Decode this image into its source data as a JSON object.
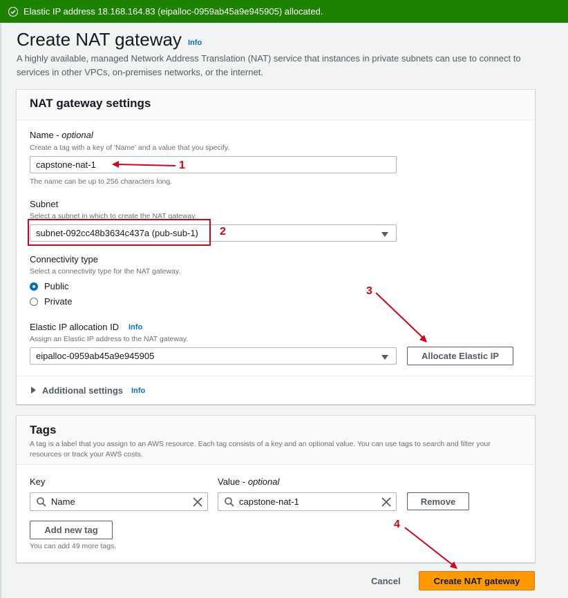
{
  "banner": {
    "message": "Elastic IP address 18.168.164.83 (eipalloc-0959ab45a9e945905) allocated.",
    "color": "#1d8102"
  },
  "page": {
    "title": "Create NAT gateway",
    "info": "Info",
    "description": "A highly available, managed Network Address Translation (NAT) service that instances in private subnets can use to connect to services in other VPCs, on-premises networks, or the internet."
  },
  "settings": {
    "heading": "NAT gateway settings",
    "name": {
      "label": "Name - ",
      "label_optional": "optional",
      "hint": "Create a tag with a key of 'Name' and a value that you specify.",
      "value": "capstone-nat-1",
      "constraint": "The name can be up to 256 characters long."
    },
    "subnet": {
      "label": "Subnet",
      "hint": "Select a subnet in which to create the NAT gateway.",
      "value": "subnet-092cc48b3634c437a (pub-sub-1)"
    },
    "connectivity": {
      "label": "Connectivity type",
      "hint": "Select a connectivity type for the NAT gateway.",
      "options": [
        "Public",
        "Private"
      ],
      "selected": "Public"
    },
    "eip": {
      "label": "Elastic IP allocation ID",
      "info": "Info",
      "hint": "Assign an Elastic IP address to the NAT gateway.",
      "value": "eipalloc-0959ab45a9e945905",
      "allocate_button": "Allocate Elastic IP"
    },
    "additional": {
      "label": "Additional settings",
      "info": "Info"
    }
  },
  "tags": {
    "heading": "Tags",
    "description": "A tag is a label that you assign to an AWS resource. Each tag consists of a key and an optional value. You can use tags to search and filter your resources or track your AWS costs.",
    "key_label": "Key",
    "value_label": "Value - ",
    "value_label_optional": "optional",
    "rows": [
      {
        "key": "Name",
        "value": "capstone-nat-1"
      }
    ],
    "remove_button": "Remove",
    "add_button": "Add new tag",
    "limit_text": "You can add 49 more tags."
  },
  "footer": {
    "cancel": "Cancel",
    "create": "Create NAT gateway"
  },
  "annotations": {
    "color": "#d0021b",
    "labels": [
      "1",
      "2",
      "3",
      "4"
    ]
  },
  "colors": {
    "primary": "#ff9900",
    "link": "#0073bb"
  }
}
